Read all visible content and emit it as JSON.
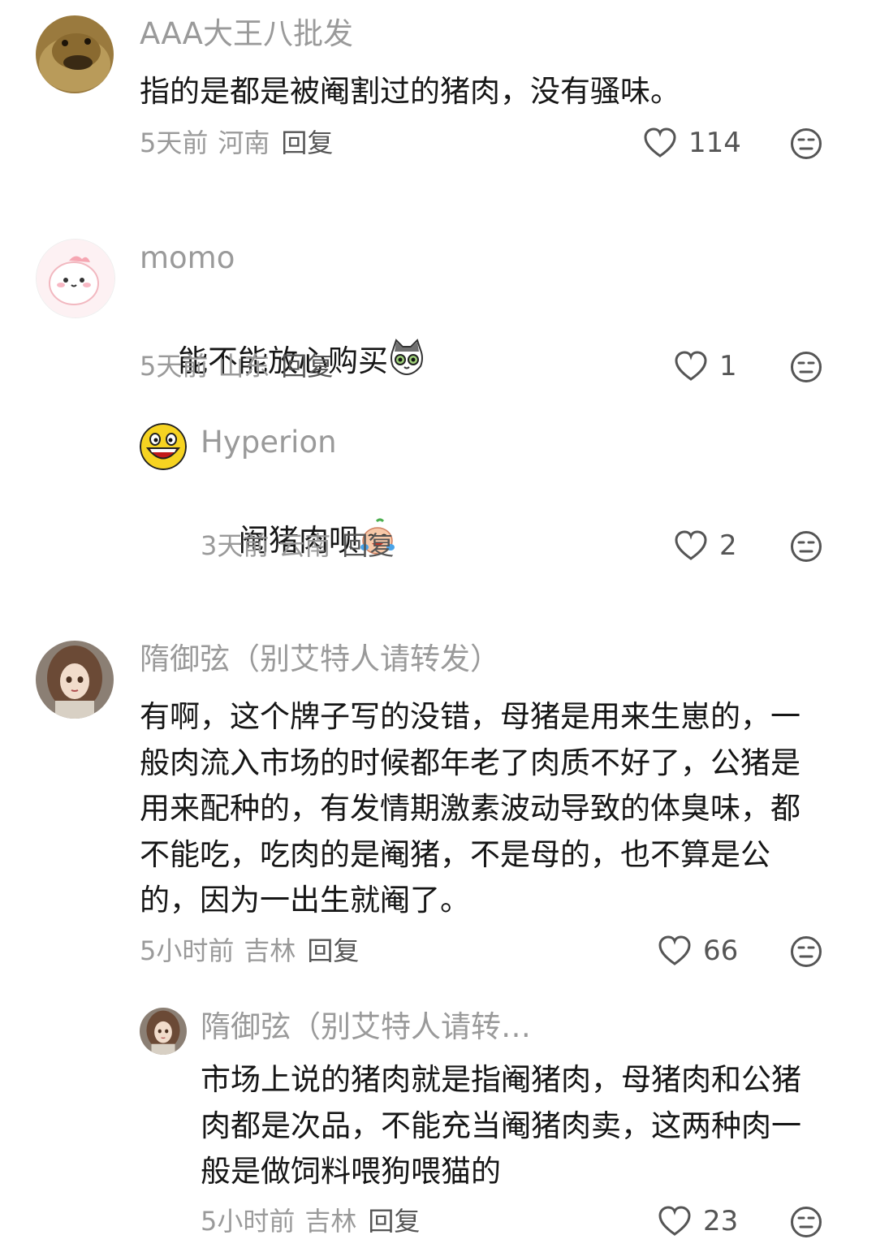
{
  "comments": [
    {
      "user": "AAA大王八批发",
      "text": "指的是都是被阉割过的猪肉，没有骚味。",
      "time": "5天前",
      "location": "河南",
      "reply_label": "回复",
      "likes": "114",
      "avatar_icon": "turtle-avatar"
    },
    {
      "user": "momo",
      "text": "能不能放心购买",
      "emoji": "cat-emoji",
      "time": "5天前",
      "location": "山东",
      "reply_label": "回复",
      "likes": "1",
      "avatar_icon": "cartoon-avatar",
      "replies": [
        {
          "user": "Hyperion",
          "text": "阉猪肉呗",
          "emoji": "crying-laugh-emoji",
          "time": "3天前",
          "location": "云南",
          "reply_label": "回复",
          "likes": "2",
          "avatar_icon": "laughing-face-avatar"
        }
      ]
    },
    {
      "user": "隋御弦（别艾特人请转发）",
      "text": "有啊，这个牌子写的没错，母猪是用来生崽的，一般肉流入市场的时候都年老了肉质不好了，公猪是用来配种的，有发情期激素波动导致的体臭味，都不能吃，吃肉的是阉猪，不是母的，也不算是公的，因为一出生就阉了。",
      "time": "5小时前",
      "location": "吉林",
      "reply_label": "回复",
      "likes": "66",
      "avatar_icon": "doll-avatar",
      "replies": [
        {
          "user": "隋御弦（别艾特人请转…",
          "text": "市场上说的猪肉就是指阉猪肉，母猪肉和公猪肉都是次品，不能充当阉猪肉卖，这两种肉一般是做饲料喂狗喂猫的",
          "time": "5小时前",
          "location": "吉林",
          "reply_label": "回复",
          "likes": "23",
          "avatar_icon": "doll-avatar"
        }
      ]
    }
  ],
  "colors": {
    "username": "#9a9a9a",
    "text": "#161616",
    "meta": "#9a9a9a",
    "icon": "#555555"
  }
}
